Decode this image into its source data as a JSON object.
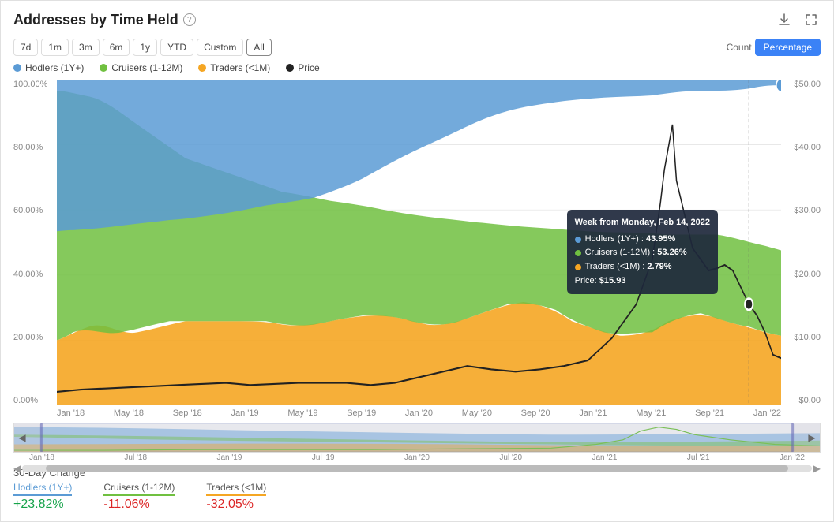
{
  "header": {
    "title": "Addresses by Time Held",
    "help_label": "?",
    "download_icon": "⬇",
    "expand_icon": "⛶"
  },
  "controls": {
    "time_buttons": [
      "7d",
      "1m",
      "3m",
      "6m",
      "1y",
      "YTD",
      "Custom",
      "All"
    ],
    "active_time": "All",
    "view_buttons": [
      "Count",
      "Percentage"
    ],
    "active_view": "Percentage"
  },
  "legend": [
    {
      "label": "Hodlers (1Y+)",
      "color": "#5b9bd5"
    },
    {
      "label": "Cruisers (1-12M)",
      "color": "#70c040"
    },
    {
      "label": "Traders (<1M)",
      "color": "#f5a623"
    },
    {
      "label": "Price",
      "color": "#222"
    }
  ],
  "y_axis_left": [
    "100.00%",
    "80.00%",
    "60.00%",
    "40.00%",
    "20.00%",
    "0.00%"
  ],
  "y_axis_right": [
    "$50.00",
    "$40.00",
    "$30.00",
    "$20.00",
    "$10.00",
    "$0.00"
  ],
  "x_axis": [
    "Jan '18",
    "May '18",
    "Sep '18",
    "Jan '19",
    "May '19",
    "Sep '19",
    "Jan '20",
    "May '20",
    "Sep '20",
    "Jan '21",
    "May '21",
    "Sep '21",
    "Jan '22"
  ],
  "tooltip": {
    "title": "Week from Monday, Feb 14, 2022",
    "rows": [
      {
        "label": "Hodlers (1Y+) : 43.95%",
        "color": "#5b9bd5"
      },
      {
        "label": "Cruisers (1-12M) : 53.26%",
        "color": "#70c040"
      },
      {
        "label": "Traders (<1M) : 2.79%",
        "color": "#f5a623"
      },
      {
        "label": "Price: $15.93",
        "color": null
      }
    ]
  },
  "mini_x_axis": [
    "Jan '18",
    "Jul '18",
    "Jan '19",
    "Jul '19",
    "Jan '20",
    "Jul '20",
    "Jan '21",
    "Jul '21",
    "Jan '22"
  ],
  "change_section": {
    "title": "30-Day Change",
    "items": [
      {
        "label": "Hodlers (1Y+)",
        "color": "#5b9bd5",
        "value": "+23.82%",
        "positive": true
      },
      {
        "label": "Cruisers (1-12M)",
        "color": "#70c040",
        "value": "-11.06%",
        "positive": false
      },
      {
        "label": "Traders (<1M)",
        "color": "#f5a623",
        "value": "-32.05%",
        "positive": false
      }
    ]
  }
}
